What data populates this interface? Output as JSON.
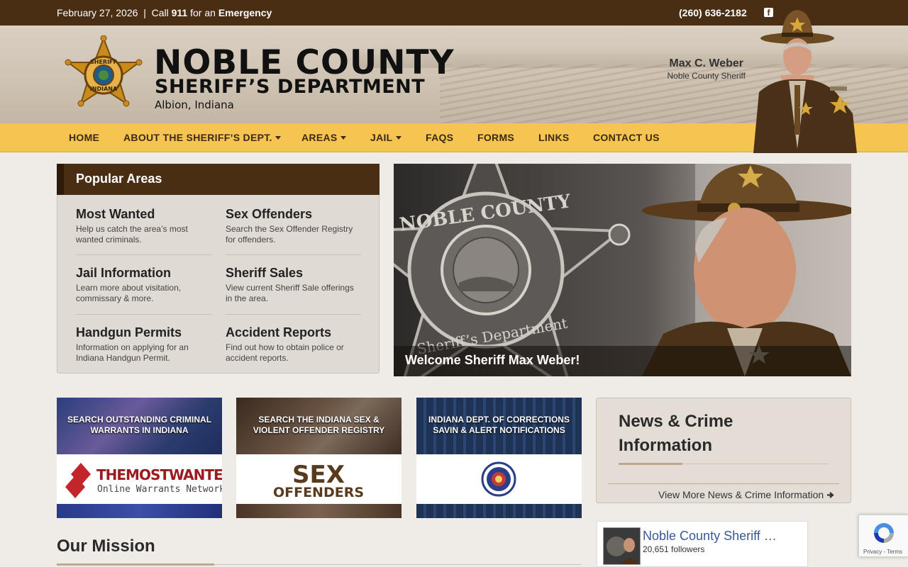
{
  "topbar": {
    "date": "February 27, 2026",
    "separator": "|",
    "call_prefix": "Call",
    "emergency_number": "911",
    "call_mid": "for an",
    "emergency_word": "Emergency",
    "phone": "(260) 636-2182",
    "facebook_icon": "facebook-icon"
  },
  "header": {
    "title_line1": "NOBLE COUNTY",
    "title_line2": "SHERIFF’S DEPARTMENT",
    "location": "Albion, Indiana",
    "badge_text_top": "SHERIFF",
    "badge_text_bottom": "INDIANA",
    "sheriff_name": "Max C. Weber",
    "sheriff_title": "Noble County Sheriff"
  },
  "nav": {
    "items": [
      {
        "label": "HOME"
      },
      {
        "label": "ABOUT THE SHERIFF’S DEPT."
      },
      {
        "label": "AREAS"
      },
      {
        "label": "JAIL"
      },
      {
        "label": "FAQS"
      },
      {
        "label": "FORMS"
      },
      {
        "label": "LINKS"
      },
      {
        "label": "CONTACT US"
      }
    ]
  },
  "popular": {
    "heading": "Popular Areas",
    "items": [
      {
        "title": "Most Wanted",
        "desc": "Help us catch the area’s most wanted criminals."
      },
      {
        "title": "Sex Offenders",
        "desc": "Search the Sex Offender Registry for offenders."
      },
      {
        "title": "Jail Information",
        "desc": "Learn more about visitation, commissary & more."
      },
      {
        "title": "Sheriff Sales",
        "desc": "View current Sheriff Sale offerings in the area."
      },
      {
        "title": "Handgun Permits",
        "desc": "Information on applying for an Indiana Handgun Permit."
      },
      {
        "title": "Accident Reports",
        "desc": "Find out how to obtain police or accident reports."
      }
    ]
  },
  "slider": {
    "caption": "Welcome Sheriff Max Weber!",
    "badge_text_top": "NOBLE COUNTY",
    "badge_text_bottom": "Sheriff’s Department"
  },
  "tiles": [
    {
      "heading": "SEARCH OUTSTANDING CRIMINAL WARRANTS IN INDIANA",
      "logo_line1": "THEMOSTWANTED.NET",
      "logo_line2": "Online Warrants Network"
    },
    {
      "heading": "SEARCH THE INDIANA SEX & VIOLENT OFFENDER REGISTRY",
      "logo_line1": "SEX",
      "logo_line2": "OFFENDERS"
    },
    {
      "heading": "INDIANA DEPT. OF CORRECTIONS SAVIN & ALERT NOTIFICATIONS"
    }
  ],
  "news": {
    "heading": "News & Crime Information",
    "more_link": "View More News & Crime Information",
    "arrow_icon": "arrow-right-icon"
  },
  "facebook_widget": {
    "page_name": "Noble County Sheriff …",
    "followers": "20,651 followers"
  },
  "mission": {
    "heading": "Our Mission"
  },
  "recaptcha": {
    "privacy": "Privacy",
    "dash": "-",
    "terms": "Terms"
  },
  "colors": {
    "brown_dark": "#4a2e14",
    "nav_gold": "#f5c451",
    "page_bg": "#efebe6"
  }
}
